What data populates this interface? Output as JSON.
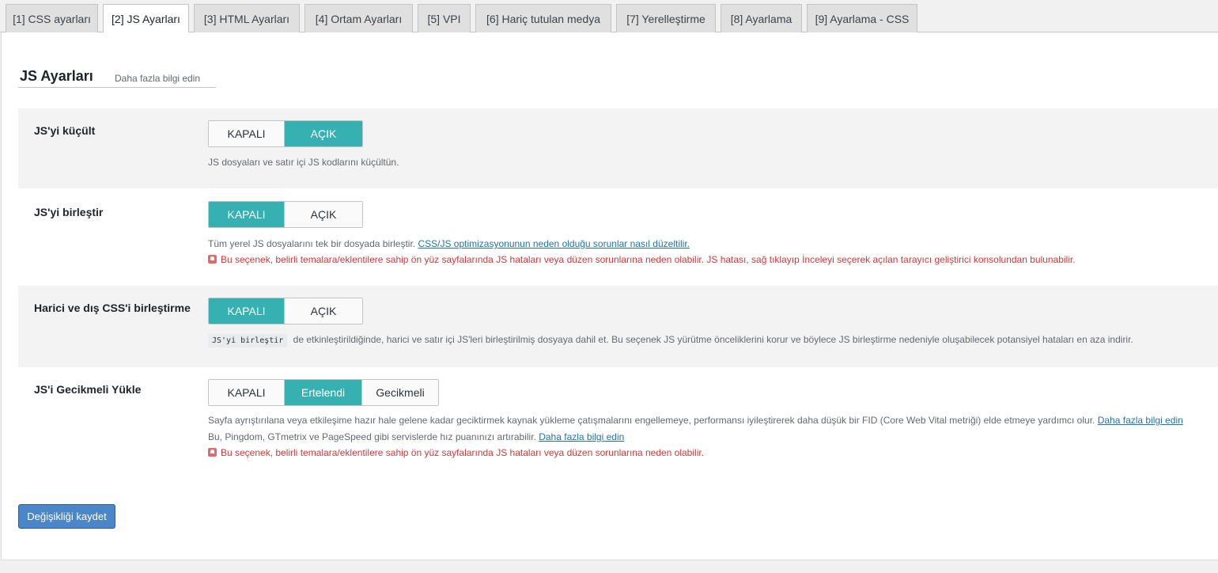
{
  "tabs": [
    {
      "label": "[1] CSS ayarları"
    },
    {
      "label": "[2] JS Ayarları"
    },
    {
      "label": "[3] HTML Ayarları"
    },
    {
      "label": "[4] Ortam Ayarları"
    },
    {
      "label": "[5] VPI"
    },
    {
      "label": "[6] Hariç tutulan medya"
    },
    {
      "label": "[7] Yerelleştirme"
    },
    {
      "label": "[8] Ayarlama"
    },
    {
      "label": "[9] Ayarlama - CSS"
    }
  ],
  "active_tab": 1,
  "section": {
    "title": "JS Ayarları",
    "learn_more": "Daha fazla bilgi edin"
  },
  "settings": {
    "minify": {
      "label": "JS'yi küçült",
      "options": [
        "KAPALI",
        "AÇIK"
      ],
      "selected": "AÇIK",
      "description": "JS dosyaları ve satır içi JS kodlarını küçültün."
    },
    "combine": {
      "label": "JS'yi birleştir",
      "options": [
        "KAPALI",
        "AÇIK"
      ],
      "selected": "KAPALI",
      "description": "Tüm yerel JS dosyalarını tek bir dosyada birleştir.",
      "link": "CSS/JS optimizasyonunun neden olduğu sorunlar nasıl düzeltilir.",
      "warning": "Bu seçenek, belirli temalara/eklentilere sahip ön yüz sayfalarında JS hataları veya düzen sorunlarına neden olabilir. JS hatası, sağ tıklayıp İnceleyi seçerek açılan tarayıcı geliştirici konsolundan bulunabilir."
    },
    "combine_external": {
      "label": "Harici ve dış CSS'i birleştirme",
      "options": [
        "KAPALI",
        "AÇIK"
      ],
      "selected": "KAPALI",
      "code": "JS'yi birleştir",
      "description": "de etkinleştirildiğinde, harici ve satır içi JS'leri birleştirilmiş dosyaya dahil et. Bu seçenek JS yürütme önceliklerini korur ve böylece JS birleştirme nedeniyle oluşabilecek potansiyel hataları en aza indirir."
    },
    "defer": {
      "label": "JS'i Gecikmeli Yükle",
      "options": [
        "KAPALI",
        "Ertelendi",
        "Gecikmeli"
      ],
      "selected": "Ertelendi",
      "description1": "Sayfa ayrıştırılana veya etkileşime hazır hale gelene kadar geciktirmek kaynak yükleme çatışmalarını engellemeye, performansı iyileştirerek daha düşük bir FID (Core Web Vital metriği) elde etmeye yardımcı olur.",
      "link1": "Daha fazla bilgi edin",
      "description2": "Bu, Pingdom, GTmetrix ve PageSpeed gibi servislerde hız puanınızı artırabilir.",
      "link2": "Daha fazla bilgi edin",
      "warning": "Bu seçenek, belirli temalara/eklentilere sahip ön yüz sayfalarında JS hataları veya düzen sorunlarına neden olabilir."
    }
  },
  "save_label": "Değişikliği kaydet",
  "colors": {
    "toggle_on": "#36b0b0",
    "warning": "#d63638",
    "link": "#2271b1",
    "primary_button": "#4a86c8"
  }
}
